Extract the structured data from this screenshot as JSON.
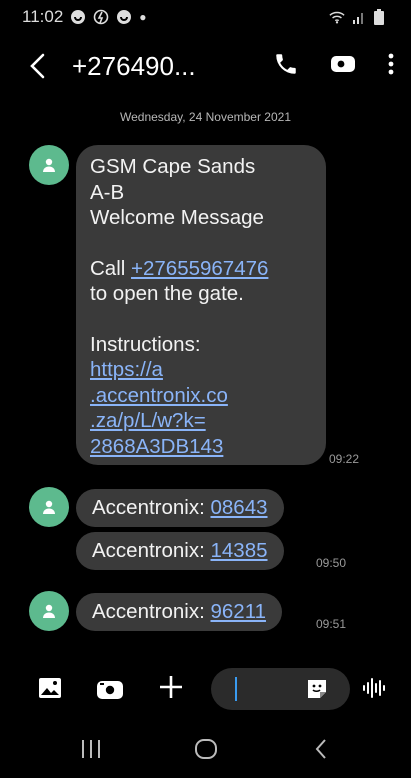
{
  "status_bar": {
    "time": "11:02"
  },
  "app_bar": {
    "contact": "+276490..."
  },
  "thread": {
    "date_separator": "Wednesday, 24 November 2021",
    "messages": [
      {
        "lines": [
          "GSM Cape Sands",
          "A-B",
          "Welcome Message"
        ],
        "call_prefix": "Call ",
        "call_number": "+27655967476",
        "call_suffix": "to open the gate.",
        "instructions_label": "Instructions:",
        "url_lines": [
          "https://a",
          ".accentronix.co",
          ".za/p/L/w?k=",
          "2868A3DB143"
        ],
        "time": "09:22"
      },
      {
        "prefix": "Accentronix: ",
        "code": "08643"
      },
      {
        "prefix": "Accentronix: ",
        "code": "14385",
        "time": "09:50"
      },
      {
        "prefix": "Accentronix: ",
        "code": "96211",
        "time": "09:51"
      }
    ]
  },
  "colors": {
    "accent": "#3a9bf0",
    "link": "#8ab4f8",
    "avatar": "#5dba8e",
    "bubble": "#3a3a3a"
  }
}
